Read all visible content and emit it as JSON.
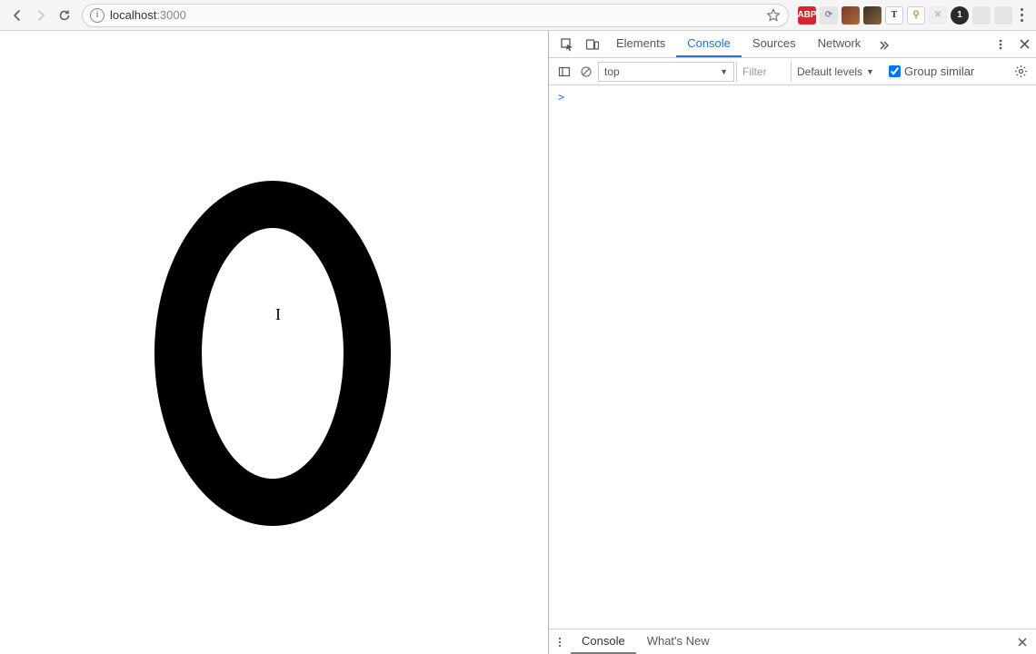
{
  "browser": {
    "url_host": "localhost",
    "url_port": ":3000",
    "badge_count": "1",
    "extensions": [
      {
        "name": "abp",
        "label": "ABP"
      },
      {
        "name": "ext-gray-1",
        "label": "⟳"
      },
      {
        "name": "ext-img-1",
        "label": ""
      },
      {
        "name": "ext-img-2",
        "label": ""
      },
      {
        "name": "ext-t",
        "label": "T"
      },
      {
        "name": "ext-pin",
        "label": "⚲"
      },
      {
        "name": "ext-dim",
        "label": "✕"
      }
    ]
  },
  "page": {
    "content_display": "0"
  },
  "devtools": {
    "tabs": {
      "elements": "Elements",
      "console": "Console",
      "sources": "Sources",
      "network": "Network"
    },
    "active_tab": "Console",
    "subbar": {
      "context": "top",
      "filter_placeholder": "Filter",
      "levels": "Default levels",
      "group_similar": "Group similar"
    },
    "prompt_symbol": ">",
    "drawer": {
      "console": "Console",
      "whats_new": "What's New"
    }
  }
}
